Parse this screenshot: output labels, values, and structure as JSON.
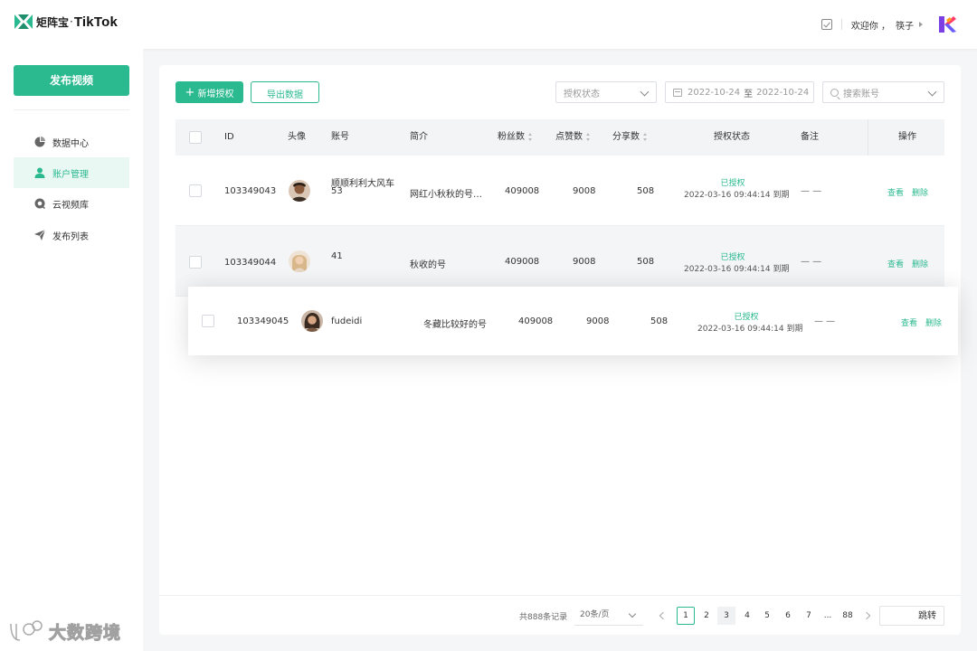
{
  "header": {
    "brand_cn": "矩阵宝",
    "brand_dot": "·",
    "brand_en": "TikTok",
    "welcome": "欢迎你 ，",
    "user": "筷子"
  },
  "sidebar": {
    "publish_label": "发布视频",
    "items": [
      {
        "label": "数据中心",
        "icon": "pie-chart-icon"
      },
      {
        "label": "账户管理",
        "icon": "user-icon",
        "active": true
      },
      {
        "label": "云视频库",
        "icon": "cloud-video-icon"
      },
      {
        "label": "发布列表",
        "icon": "send-icon"
      }
    ]
  },
  "toolbar": {
    "add_auth_label": "新增授权",
    "export_label": "导出数据",
    "status_placeholder": "授权状态",
    "date_start": "2022-10-24",
    "date_sep": "至",
    "date_end": "2022-10-24",
    "search_placeholder": "搜索账号"
  },
  "table": {
    "columns": {
      "id": "ID",
      "avatar": "头像",
      "account": "账号",
      "intro": "简介",
      "fans": "粉丝数",
      "likes": "点赞数",
      "shares": "分享数",
      "status": "授权状态",
      "remark": "备注",
      "actions": "操作"
    },
    "rows": [
      {
        "id": "103349043",
        "account_line1": "顺顺利利大风车",
        "account_line2": "53",
        "intro": "网红小秋秋的号…",
        "fans": "409008",
        "likes": "9008",
        "shares": "508",
        "status": "已授权",
        "expiry": "2022-03-16 09:44:14 到期",
        "remark": "— —",
        "view": "查看",
        "delete": "删除"
      },
      {
        "id": "103349044",
        "account_line1": "41",
        "account_line2": "",
        "intro": "秋收的号",
        "fans": "409008",
        "likes": "9008",
        "shares": "508",
        "status": "已授权",
        "expiry": "2022-03-16 09:44:14 到期",
        "remark": "— —",
        "view": "查看",
        "delete": "删除"
      },
      {
        "id": "103349045",
        "account_line1": "fudeidi",
        "account_line2": "",
        "intro": "冬藏比较好的号",
        "fans": "409008",
        "likes": "9008",
        "shares": "508",
        "status": "已授权",
        "expiry": "2022-03-16 09:44:14 到期",
        "remark": "— —",
        "view": "查看",
        "delete": "删除"
      }
    ]
  },
  "pagination": {
    "total": "共888条记录",
    "page_size": "20条/页",
    "pages": [
      "1",
      "2",
      "3",
      "4",
      "5",
      "6",
      "7",
      "...",
      "88"
    ],
    "current": "1",
    "jump_label": "跳转"
  },
  "watermark": "大数跨境",
  "colors": {
    "accent": "#2bb98f",
    "background": "#f5f6f8"
  }
}
